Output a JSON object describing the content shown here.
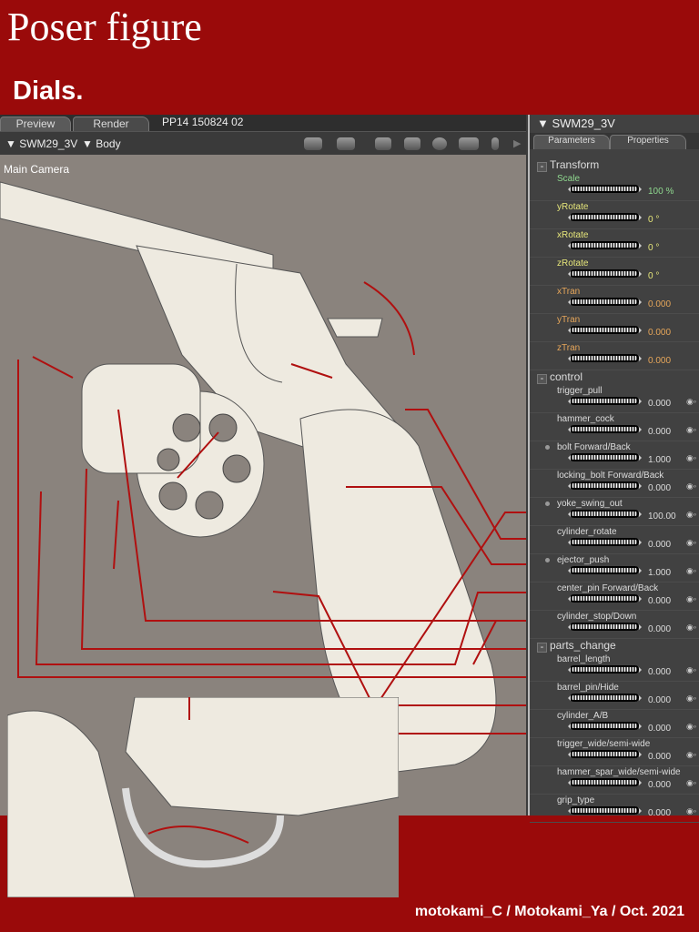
{
  "title": "Poser figure",
  "subtitle": "Dials.",
  "tabs": [
    {
      "label": "Preview",
      "active": true
    },
    {
      "label": "Render",
      "active": false
    }
  ],
  "tab_info": "PP14  150824  02",
  "toolbar": {
    "figure": "SWM29_3V",
    "part": "Body"
  },
  "viewport": {
    "camera": "Main Camera"
  },
  "panel": {
    "title": "SWM29_3V",
    "tabs": [
      "Parameters",
      "Properties"
    ],
    "sections": [
      {
        "name": "Transform",
        "params": [
          {
            "label": "Scale",
            "value": "100 %",
            "color": "#8fd88f"
          },
          {
            "label": "yRotate",
            "value": "0 °",
            "color": "#e6e67a"
          },
          {
            "label": "xRotate",
            "value": "0 °",
            "color": "#e6e67a"
          },
          {
            "label": "zRotate",
            "value": "0 °",
            "color": "#e6e67a"
          },
          {
            "label": "xTran",
            "value": "0.000",
            "color": "#e6a65a"
          },
          {
            "label": "yTran",
            "value": "0.000",
            "color": "#e6a65a"
          },
          {
            "label": "zTran",
            "value": "0.000",
            "color": "#e6a65a"
          }
        ]
      },
      {
        "name": "control",
        "params": [
          {
            "label": "trigger_pull",
            "value": "0.000"
          },
          {
            "label": "hammer_cock",
            "value": "0.000"
          },
          {
            "label": "bolt Forward/Back",
            "value": "1.000",
            "dot": true
          },
          {
            "label": "locking_bolt Forward/Back",
            "value": "0.000"
          },
          {
            "label": "yoke_swing_out",
            "value": "100.00",
            "dot": true
          },
          {
            "label": "cylinder_rotate",
            "value": "0.000"
          },
          {
            "label": "ejector_push",
            "value": "1.000",
            "dot": true
          },
          {
            "label": "center_pin Forward/Back",
            "value": "0.000"
          },
          {
            "label": "cylinder_stop/Down",
            "value": "0.000"
          }
        ]
      },
      {
        "name": "parts_change",
        "params": [
          {
            "label": "barrel_length",
            "value": "0.000"
          },
          {
            "label": "barrel_pin/Hide",
            "value": "0.000"
          },
          {
            "label": "cylinder_A/B",
            "value": "0.000"
          },
          {
            "label": "trigger_wide/semi-wide",
            "value": "0.000"
          },
          {
            "label": "hammer_spar_wide/semi-wide",
            "value": "0.000"
          },
          {
            "label": "grip_type",
            "value": "0.000"
          }
        ]
      }
    ]
  },
  "footer": "motokami_C / Motokami_Ya / Oct. 2021",
  "colors": {
    "brand": "#9a0a0a",
    "annotation": "#b01010"
  }
}
